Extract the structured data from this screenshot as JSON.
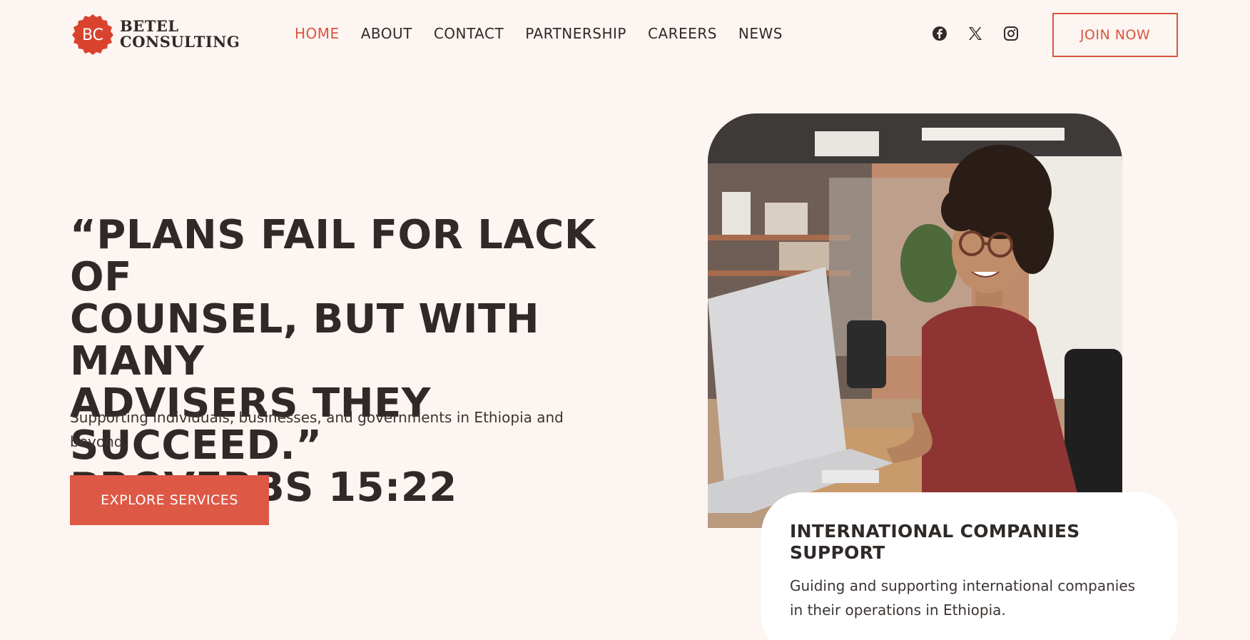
{
  "brand": {
    "seal_initials": "BC",
    "name_line1": "BETEL",
    "name_line2": "CONSULTING",
    "accent_color": "#d9553f"
  },
  "nav": {
    "items": [
      {
        "label": "HOME",
        "active": true
      },
      {
        "label": "ABOUT",
        "active": false
      },
      {
        "label": "CONTACT",
        "active": false
      },
      {
        "label": "PARTNERSHIP",
        "active": false
      },
      {
        "label": "CAREERS",
        "active": false
      },
      {
        "label": "NEWS",
        "active": false
      }
    ]
  },
  "socials": [
    {
      "icon": "facebook-icon"
    },
    {
      "icon": "x-icon"
    },
    {
      "icon": "instagram-icon"
    }
  ],
  "header": {
    "join_label": "JOIN NOW"
  },
  "hero": {
    "title_line1": "“PLANS FAIL FOR LACK OF",
    "title_line2": "COUNSEL, BUT WITH MANY",
    "title_line3": "ADVISERS THEY SUCCEED.”",
    "title_line4": "PROVERBS 15:22",
    "subtitle": "Supporting individuals, businesses, and governments in Ethiopia and beyond.",
    "cta_label": "EXPLORE SERVICES"
  },
  "card": {
    "title": "INTERNATIONAL COMPANIES SUPPORT",
    "text": "Guiding and supporting international companies in their operations in Ethiopia."
  },
  "colors": {
    "background": "#fdf5f1",
    "button": "#de5846",
    "text": "#2f2a28"
  }
}
